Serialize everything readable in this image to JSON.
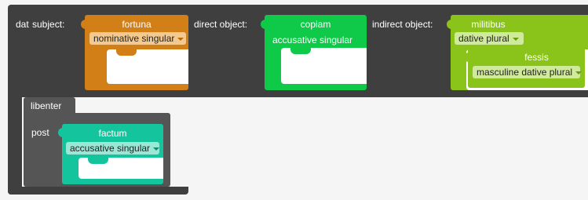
{
  "workspace": {
    "dat_block": {
      "verb": "dat",
      "subject_label": "subject:",
      "direct_object_label": "direct object:",
      "indirect_object_label": "indirect object:"
    },
    "subject_word": {
      "word": "fortuna",
      "form": "nominative singular",
      "color": "#d17f16"
    },
    "direct_object_word": {
      "word": "copiam",
      "form": "accusative singular",
      "color": "#0fca48"
    },
    "indirect_object_word": {
      "word": "militibus",
      "form": "dative plural",
      "color": "#8ac31a"
    },
    "modifier_word": {
      "word": "fessis",
      "form": "masculine dative plural",
      "color": "#8ac31a"
    },
    "adverb_block": {
      "word": "libenter",
      "color": "#555555"
    },
    "preposition_block": {
      "word": "post",
      "color": "#555555"
    },
    "object_of_preposition": {
      "word": "factum",
      "form": "accusative singular",
      "color": "#14c49c"
    }
  },
  "colors": {
    "verb_block": "#3f3f3f",
    "adverb_block": "#555555",
    "background": "#f5f5f5"
  }
}
